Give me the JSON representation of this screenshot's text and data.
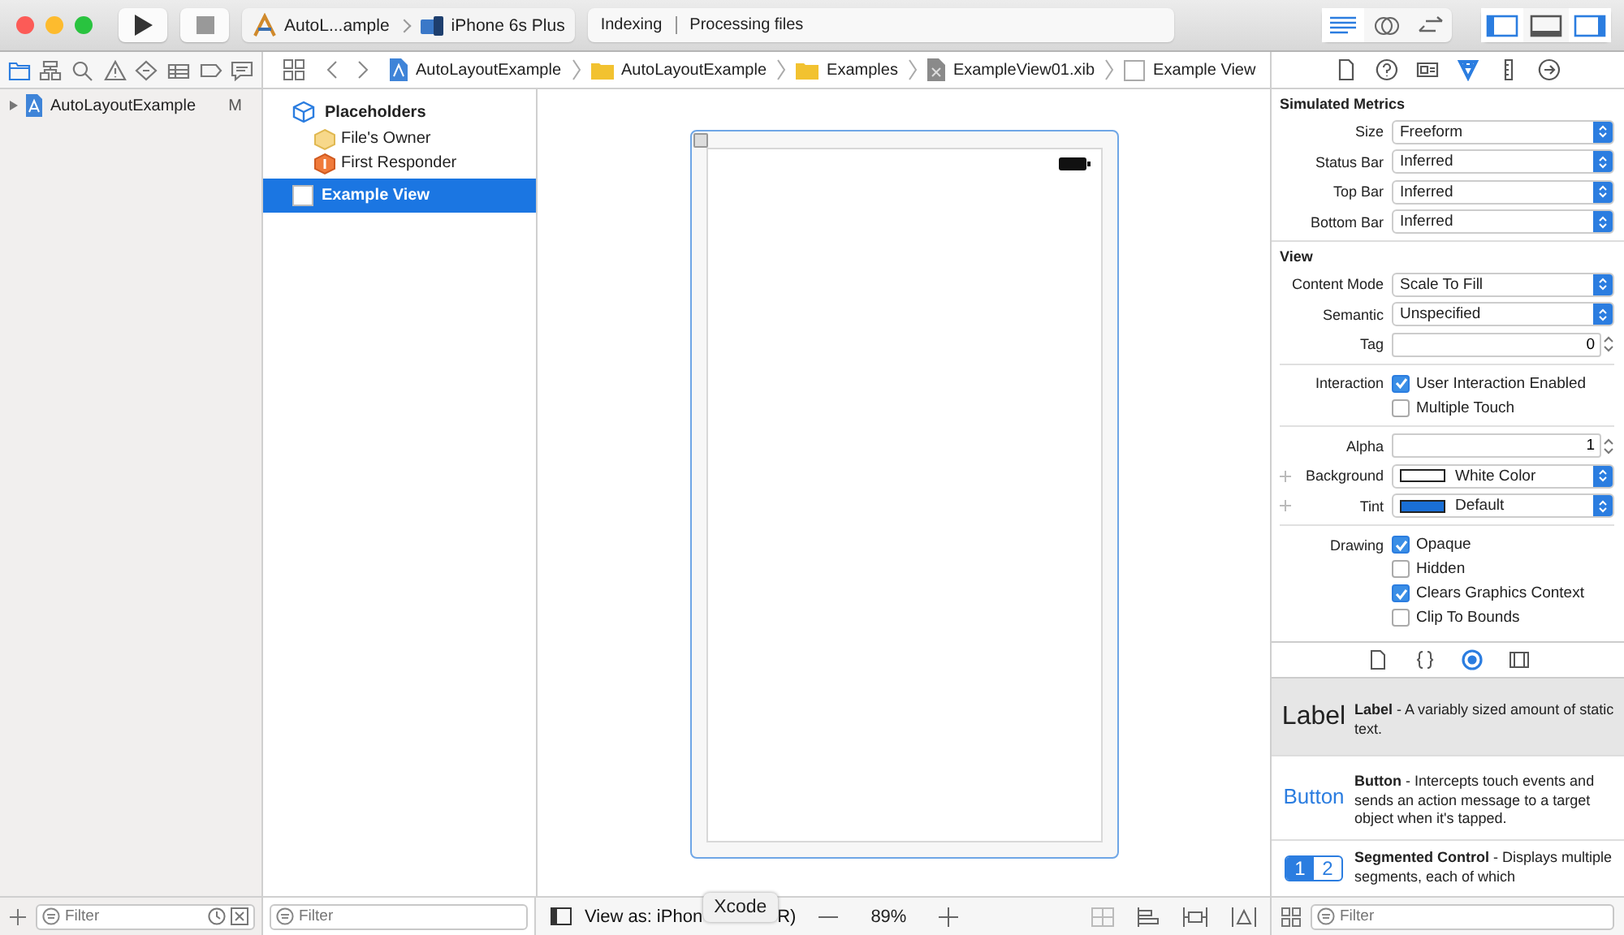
{
  "toolbar": {
    "scheme": "AutoL...ample",
    "device": "iPhone 6s Plus",
    "activity": [
      "Indexing",
      "Processing files"
    ],
    "editor_modes": [
      {
        "selected": true
      },
      {
        "selected": false
      },
      {
        "selected": false
      }
    ],
    "panels": [
      {
        "on": true
      },
      {
        "on": false
      },
      {
        "on": true
      }
    ]
  },
  "navigator": {
    "tabs": [
      {
        "selected": true
      },
      {
        "selected": false
      },
      {
        "selected": false
      },
      {
        "selected": false
      },
      {
        "selected": false
      },
      {
        "selected": false
      },
      {
        "selected": false
      },
      {
        "selected": false
      }
    ],
    "items": [
      {
        "label": "AutoLayoutExample",
        "badge": "M",
        "expanded": false
      }
    ],
    "filter": {
      "placeholder": "Filter"
    }
  },
  "jump_bar": [
    {
      "label": "AutoLayoutExample",
      "kind": "project"
    },
    {
      "label": "AutoLayoutExample",
      "kind": "folder"
    },
    {
      "label": "Examples",
      "kind": "folder"
    },
    {
      "label": "ExampleView01.xib",
      "kind": "xib"
    },
    {
      "label": "Example View",
      "kind": "view"
    }
  ],
  "outline": {
    "header": "Placeholders",
    "items": [
      {
        "label": "File's Owner",
        "kind": "owner",
        "selected": false
      },
      {
        "label": "First Responder",
        "kind": "responder",
        "selected": false
      }
    ],
    "views": [
      {
        "label": "Example View",
        "selected": true
      }
    ],
    "filter": {
      "placeholder": "Filter"
    }
  },
  "canvas": {
    "view_as": "View as: iPhon",
    "view_as_tail": "R)",
    "zoom": "89%",
    "tooltip": "Xcode"
  },
  "inspector": {
    "tabs": [
      {
        "selected": false
      },
      {
        "selected": false
      },
      {
        "selected": false
      },
      {
        "selected": true
      },
      {
        "selected": false
      },
      {
        "selected": false
      }
    ],
    "sections": [
      {
        "title": "Simulated Metrics",
        "groups": [
          [
            {
              "kind": "popup",
              "label": "Size",
              "value": "Freeform"
            },
            {
              "kind": "popup",
              "label": "Status Bar",
              "value": "Inferred"
            },
            {
              "kind": "popup",
              "label": "Top Bar",
              "value": "Inferred"
            },
            {
              "kind": "popup",
              "label": "Bottom Bar",
              "value": "Inferred"
            }
          ]
        ]
      },
      {
        "title": "View",
        "groups": [
          [
            {
              "kind": "popup",
              "label": "Content Mode",
              "value": "Scale To Fill"
            },
            {
              "kind": "popup",
              "label": "Semantic",
              "value": "Unspecified"
            },
            {
              "kind": "stepper",
              "label": "Tag",
              "value": "0"
            }
          ],
          [
            {
              "kind": "checks",
              "label": "Interaction",
              "options": [
                {
                  "text": "User Interaction Enabled",
                  "checked": true
                },
                {
                  "text": "Multiple Touch",
                  "checked": false
                }
              ]
            }
          ],
          [
            {
              "kind": "stepper",
              "label": "Alpha",
              "value": "1"
            },
            {
              "kind": "color",
              "label": "Background",
              "value": "White Color",
              "color": "#ffffff"
            },
            {
              "kind": "color",
              "label": "Tint",
              "value": "Default",
              "color": "#1a6fd6"
            }
          ],
          [
            {
              "kind": "checks",
              "label": "Drawing",
              "options": [
                {
                  "text": "Opaque",
                  "checked": true
                },
                {
                  "text": "Hidden",
                  "checked": false
                },
                {
                  "text": "Clears Graphics Context",
                  "checked": true
                },
                {
                  "text": "Clip To Bounds",
                  "checked": false
                }
              ]
            }
          ]
        ]
      }
    ]
  },
  "library": {
    "tabs": [
      {
        "selected": false
      },
      {
        "selected": false
      },
      {
        "selected": true
      },
      {
        "selected": false
      }
    ],
    "items": [
      {
        "kind": "label",
        "preview": "Label",
        "title": "Label",
        "description": "- A variably sized amount of static text.",
        "selected": true
      },
      {
        "kind": "button",
        "preview": "Button",
        "title": "Button",
        "description": "- Intercepts touch events and sends an action message to a target object when it's tapped.",
        "selected": false
      },
      {
        "kind": "segmented",
        "segments": [
          "1",
          "2"
        ],
        "title": "Segmented Control",
        "description": "- Displays multiple segments, each of which",
        "selected": false
      }
    ],
    "filter": {
      "placeholder": "Filter"
    }
  }
}
